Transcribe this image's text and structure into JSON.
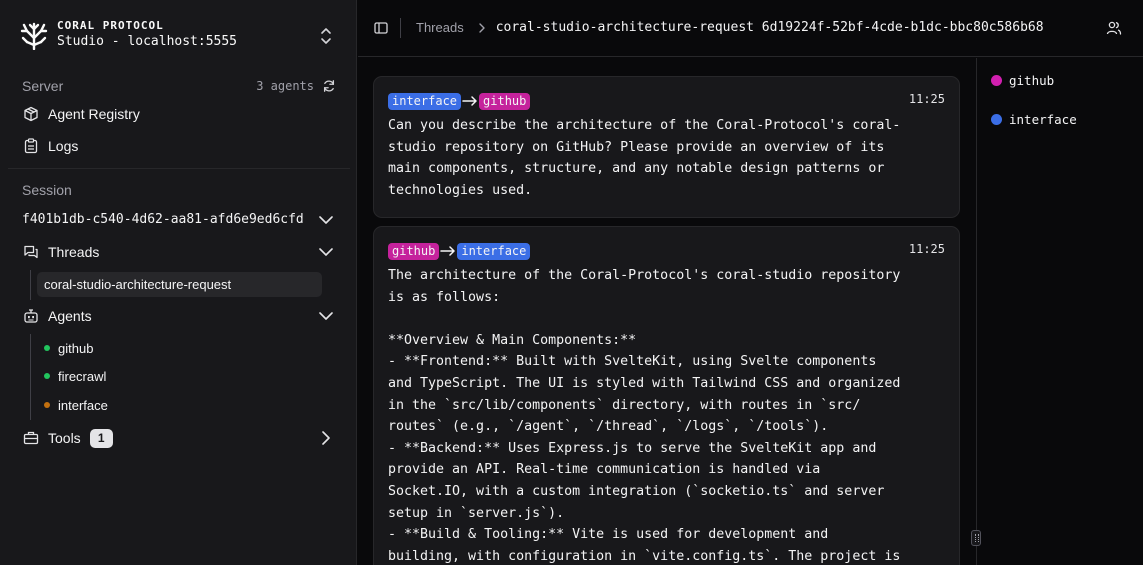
{
  "brand": {
    "title": "CORAL PROTOCOL",
    "subtitle": "Studio - localhost:5555"
  },
  "sidebar": {
    "server_label": "Server",
    "agents_count": "3 agents",
    "nav": {
      "agent_registry": "Agent Registry",
      "logs": "Logs"
    },
    "session_label": "Session",
    "session_id": "f401b1db-c540-4d62-aa81-afd6e9ed6cfd",
    "threads_label": "Threads",
    "threads": [
      "coral-studio-architecture-request"
    ],
    "agents_label": "Agents",
    "agents": [
      {
        "name": "github",
        "color": "#22c55e"
      },
      {
        "name": "firecrawl",
        "color": "#22c55e"
      },
      {
        "name": "interface",
        "color": "#c2700f"
      }
    ],
    "tools_label": "Tools",
    "tools_count": "1"
  },
  "header": {
    "breadcrumb_root": "Threads",
    "breadcrumb_current": "coral-studio-architecture-request 6d19224f-52bf-4cde-b1dc-bbc80c586b68"
  },
  "messages": [
    {
      "from": "interface",
      "to": "github",
      "time": "11:25",
      "body": "Can you describe the architecture of the Coral-Protocol's coral-\nstudio repository on GitHub? Please provide an overview of its\nmain components, structure, and any notable design patterns or\ntechnologies used."
    },
    {
      "from": "github",
      "to": "interface",
      "time": "11:25",
      "body": "The architecture of the Coral-Protocol's coral-studio repository\nis as follows:\n\n**Overview & Main Components:**\n- **Frontend:** Built with SvelteKit, using Svelte components\nand TypeScript. The UI is styled with Tailwind CSS and organized\nin the `src/lib/components` directory, with routes in `src/\nroutes` (e.g., `/agent`, `/thread`, `/logs`, `/tools`).\n- **Backend:** Uses Express.js to serve the SvelteKit app and\nprovide an API. Real-time communication is handled via\nSocket.IO, with a custom integration (`socketio.ts` and server\nsetup in `server.js`).\n- **Build & Tooling:** Vite is used for development and\nbuilding, with configuration in `vite.config.ts`. The project is"
    }
  ],
  "participants": [
    {
      "name": "github",
      "color": "#d21fb0"
    },
    {
      "name": "interface",
      "color": "#3b6ee6"
    }
  ],
  "colors": {
    "tag_blue": "#3b6ee6",
    "tag_pink": "#c5229c",
    "active_agent": "#22c55e",
    "idle_agent": "#c2700f"
  }
}
